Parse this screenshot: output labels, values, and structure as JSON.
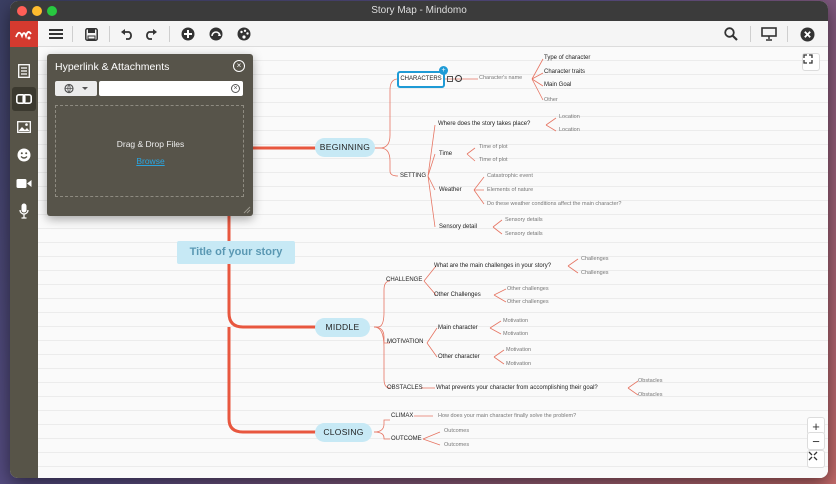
{
  "window": {
    "title": "Story Map - Mindomo"
  },
  "colors": {
    "accent": "#d43a2f",
    "selection": "#1f9bd6",
    "pill": "#c7e9f5",
    "branch": "#e67563"
  },
  "toolbar": {
    "icons": [
      "menu-icon",
      "save-icon",
      "undo-icon",
      "redo-icon",
      "add-topic-icon",
      "add-subtopic-icon",
      "palette-icon",
      "search-icon",
      "presentation-icon",
      "close-icon"
    ]
  },
  "sidebar": {
    "items": [
      "notes-icon",
      "link-icon",
      "image-icon",
      "emoji-icon",
      "video-icon",
      "microphone-icon"
    ]
  },
  "panel": {
    "title": "Hyperlink & Attachments",
    "link_input_value": "",
    "drop_label": "Drag & Drop Files",
    "browse_label": "Browse"
  },
  "map": {
    "central": "Title of your story",
    "beginning": {
      "label": "BEGINNING",
      "characters": "CHARACTERS",
      "characters_name": "Character's name",
      "char_children": [
        "Type of character",
        "Character traits",
        "Main Goal",
        "Other"
      ],
      "setting": "SETTING",
      "where": "Where does the story takes place?",
      "where_children": [
        "Location",
        "Location"
      ],
      "time": "Time",
      "time_children": [
        "Time of plot",
        "Time of plot"
      ],
      "weather": "Weather",
      "weather_children": [
        "Catastrophic event",
        "Elements of nature",
        "Do these weather conditions affect the main character?"
      ],
      "sensory": "Sensory detail",
      "sensory_children": [
        "Sensory details",
        "Sensory details"
      ]
    },
    "middle": {
      "label": "MIDDLE",
      "challenge": "CHALLENGE",
      "main_challenges": "What are the main challenges in your story?",
      "main_challenges_children": [
        "Challenges",
        "Challenges"
      ],
      "other_challenges": "Other Challenges",
      "other_challenges_children": [
        "Other challenges",
        "Other challenges"
      ],
      "motivation": "MOTIVATION",
      "main_character": "Main character",
      "main_character_children": [
        "Motivation",
        "Motivation"
      ],
      "other_character": "Other character",
      "other_character_children": [
        "Motivation",
        "Motivation"
      ],
      "obstacles": "OBSTACLES",
      "prevents": "What prevents your character from accomplishing their goal?",
      "prevents_children": [
        "Obstacles",
        "Obstacles"
      ]
    },
    "closing": {
      "label": "CLOSING",
      "climax": "CLIMAX",
      "climax_q": "How does your main character finally solve the problem?",
      "outcome": "OUTCOME",
      "outcome_children": [
        "Outcomes",
        "Outcomes"
      ]
    }
  },
  "zoom": {
    "in": "+",
    "out": "−"
  }
}
